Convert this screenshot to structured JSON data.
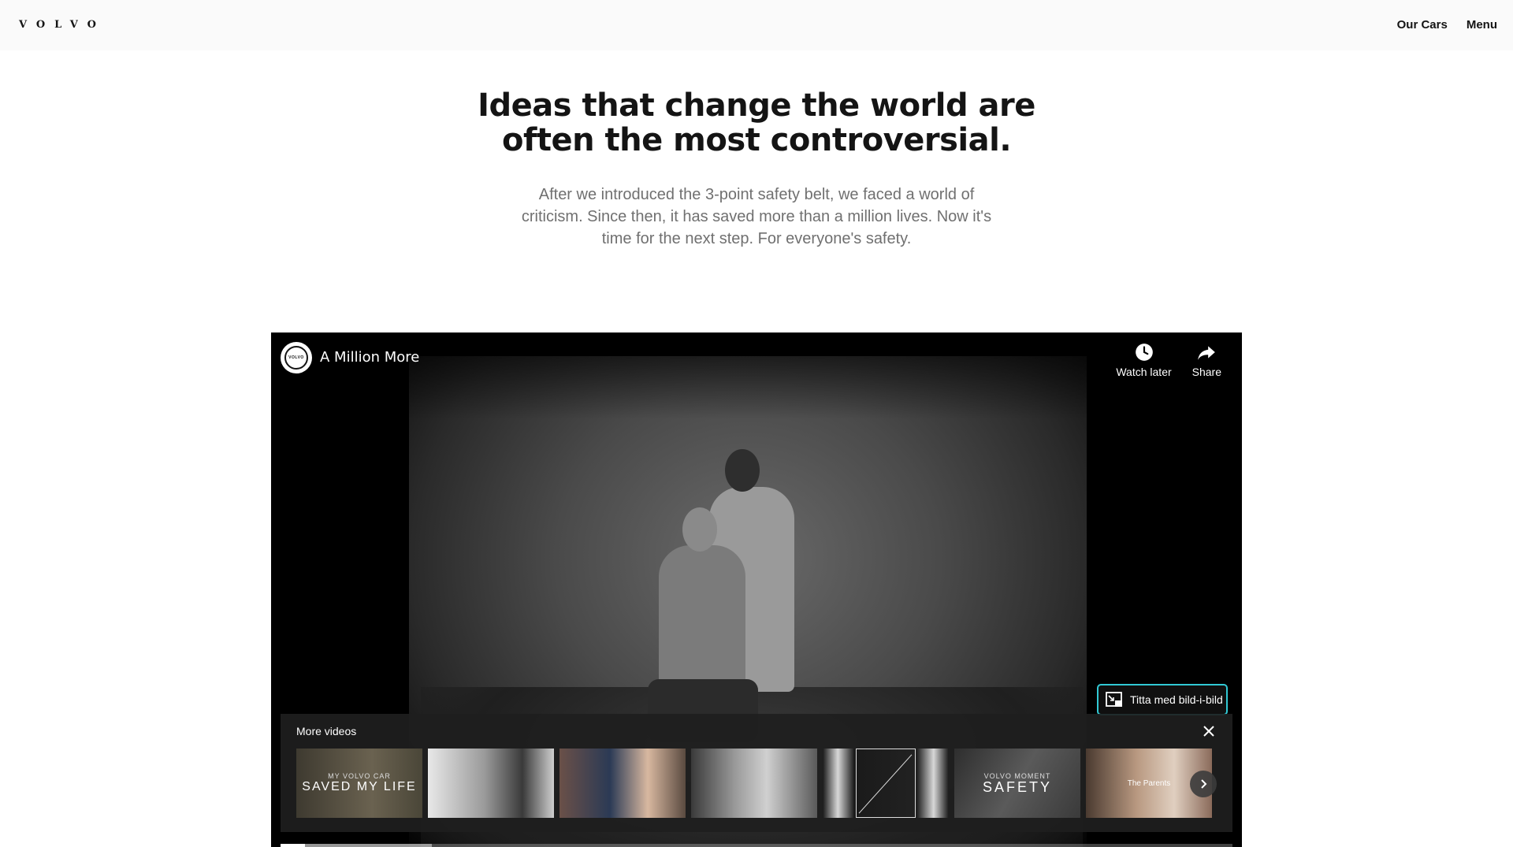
{
  "header": {
    "logo_text": "VOLVO",
    "nav": [
      {
        "label": "Our Cars"
      },
      {
        "label": "Menu"
      }
    ]
  },
  "hero": {
    "title_line1": "Ideas that change the world are",
    "title_line2": "often the most controversial.",
    "body_line1": "After we introduced the 3-point safety belt, we faced a world of",
    "body_line2": "criticism. Since then, it has saved more than a million lives. Now it's",
    "body_line3": "time for the next step. For everyone's safety."
  },
  "player": {
    "channel_logo_text": "VOLVO",
    "title": "A Million More",
    "actions": [
      {
        "label": "Watch later",
        "icon": "clock-icon"
      },
      {
        "label": "Share",
        "icon": "share-arrow-icon"
      }
    ],
    "pip_label": "Titta med bild-i-bild",
    "more_videos": {
      "label": "More videos",
      "thumbnails": [
        {
          "small": "MY VOLVO CAR",
          "big": "SAVED MY LIFE"
        },
        {
          "small": "",
          "big": ""
        },
        {
          "small": "",
          "big": ""
        },
        {
          "small": "",
          "big": ""
        },
        {
          "small": "",
          "big": ""
        },
        {
          "small": "VOLVO MOMENT",
          "big": "SAFETY"
        },
        {
          "small": "",
          "big": "The Parents"
        }
      ]
    },
    "progress": {
      "played_fraction": 0.026,
      "buffered_fraction": 0.159
    },
    "colors": {
      "pip_border": "#31c9d4"
    }
  }
}
